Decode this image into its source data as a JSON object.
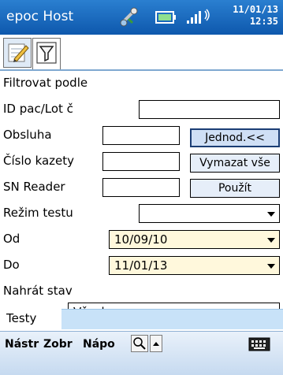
{
  "titlebar": {
    "app_title": "epoc Host",
    "date": "11/01/13",
    "time": "12:35",
    "icons": [
      "sync-icon",
      "battery-icon",
      "signal-icon"
    ]
  },
  "tabs": [
    {
      "name": "edit-tab",
      "icon": "notepad-pencil-icon",
      "active": false
    },
    {
      "name": "filter-tab",
      "icon": "funnel-filter-icon",
      "active": true
    }
  ],
  "form": {
    "heading": "Filtrovat podle",
    "id_label": "ID pac/Lot č",
    "operator_label": "Obsluha",
    "cartridge_label": "Číslo kazety",
    "reader_label": "SN Reader",
    "test_mode_label": "Režim testu",
    "from_label": "Od",
    "from_value": "10/09/10",
    "to_label": "Do",
    "to_value": "11/01/13",
    "upload_label": "Nahrát stav",
    "upload_value": "Všechny",
    "tests_label": "Testy"
  },
  "buttons": {
    "simple": "Jednod.<<",
    "clear_all": "Vymazat vše",
    "apply": "Použít"
  },
  "menubar": {
    "tools": "Nástr",
    "view": "Zobr",
    "help": "Nápo"
  },
  "colors": {
    "titlebar": "#1565c0",
    "date_field_bg": "#fff8dc",
    "button_bg": "#e6eef9",
    "tests_bg": "#c8e2f8"
  }
}
